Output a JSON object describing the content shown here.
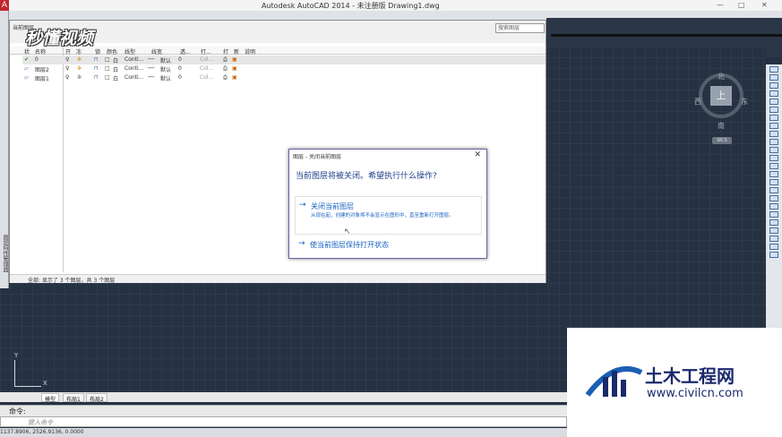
{
  "titlebar": {
    "title": "Autodesk AutoCAD 2014 - 未注册版    Drawing1.dwg",
    "minimize": "—",
    "maximize": "□",
    "close": "✕"
  },
  "watermark": {
    "logo_text": "秒懂视频"
  },
  "left_strip": {
    "label": "图层特性管理器"
  },
  "layer_panel": {
    "header_title": "当前图层",
    "search_placeholder": "搜索图层",
    "columns": [
      "状",
      "名称",
      "开",
      "冻",
      "锁",
      "颜色",
      "线型",
      "线宽",
      "透...",
      "打...",
      "打",
      "新",
      "说明"
    ],
    "rows": [
      {
        "name": "0",
        "color": "白",
        "linetype": "Conti...",
        "lineweight": "默认",
        "transparency": "0",
        "plotstyle": "Col..."
      },
      {
        "name": "图层2",
        "color": "白",
        "linetype": "Conti...",
        "lineweight": "默认",
        "transparency": "0",
        "plotstyle": "Col..."
      },
      {
        "name": "图层1",
        "color": "白",
        "linetype": "Conti...",
        "lineweight": "默认",
        "transparency": "0",
        "plotstyle": "Col..."
      }
    ],
    "status": "全部: 显示了 3 个图层，共 3 个图层"
  },
  "dialog": {
    "title": "图层 - 关闭当前图层",
    "question": "当前图层将被关闭。希望执行什么操作?",
    "option1_title": "关闭当前图层",
    "option1_desc": "从现在起，创建的对象将不会显示在图形中，直至重新打开图层。",
    "option2_title": "使当前图层保持打开状态",
    "close": "✕"
  },
  "viewcube": {
    "top": "上",
    "north": "北",
    "south": "南",
    "east": "东",
    "west": "西",
    "wcs": "WCS"
  },
  "ucs": {
    "x": "X",
    "y": "Y"
  },
  "tabs": [
    "模型",
    "布局1",
    "布局2"
  ],
  "command": {
    "history_label": "命令:",
    "prompt": "键入命令"
  },
  "statusline": {
    "coords": "1137.8906, 2526.9136, 0.0000"
  },
  "brand": {
    "name": "土木工程网",
    "url": "www.civilcn.com"
  }
}
